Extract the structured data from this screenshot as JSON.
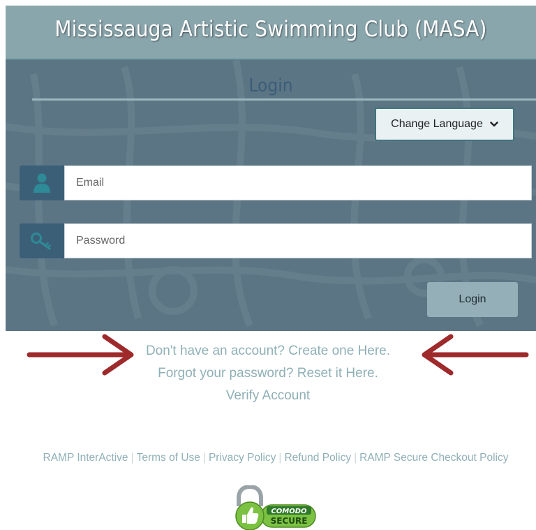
{
  "header": {
    "title": "Mississauga Artistic Swimming Club (MASA)"
  },
  "login_panel": {
    "title": "Login",
    "change_language_label": "Change Language",
    "email_placeholder": "Email",
    "password_placeholder": "Password",
    "login_button_label": "Login"
  },
  "links": {
    "create_account": "Don't have an account? Create one Here.",
    "reset_password": "Forgot your password? Reset it Here.",
    "verify_account": "Verify Account"
  },
  "footer": {
    "items": [
      "RAMP InterActive",
      "Terms of Use",
      "Privacy Policy",
      "Refund Policy",
      "RAMP Secure Checkout Policy"
    ],
    "separator": "|"
  },
  "badge": {
    "brand": "COMODO",
    "label": "SECURE"
  },
  "colors": {
    "header_bg": "#8aa6ad",
    "panel_bg": "#5c7584",
    "addon_bg": "#3c5f78",
    "link_color": "#8fb0b6",
    "arrow_color": "#9e2a2b",
    "badge_green": "#7cc242"
  },
  "icons": [
    "user-icon",
    "key-icon",
    "chevron-down-icon",
    "arrow-right-icon",
    "arrow-left-icon",
    "padlock-icon",
    "thumbs-up-icon"
  ]
}
